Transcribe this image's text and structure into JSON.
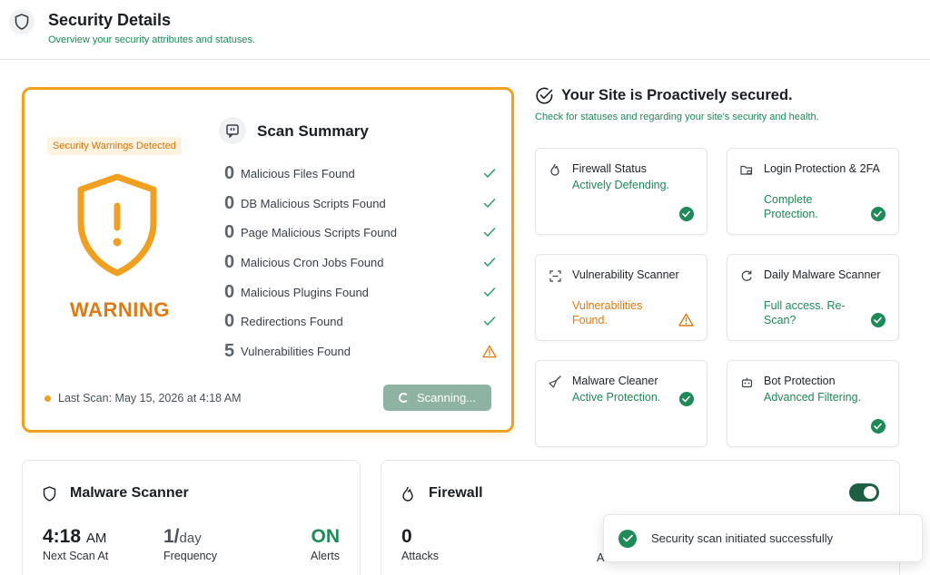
{
  "header": {
    "title": "Security Details",
    "subtitle": "Overview your security attributes and statuses."
  },
  "warning_card": {
    "badge": "Security Warnings Detected",
    "status_label": "WARNING",
    "summary_title": "Scan Summary",
    "items": [
      {
        "count": "0",
        "label": "Malicious Files Found",
        "status": "ok"
      },
      {
        "count": "0",
        "label": "DB Malicious Scripts Found",
        "status": "ok"
      },
      {
        "count": "0",
        "label": "Page Malicious Scripts Found",
        "status": "ok"
      },
      {
        "count": "0",
        "label": "Malicious Cron Jobs Found",
        "status": "ok"
      },
      {
        "count": "0",
        "label": "Malicious Plugins Found",
        "status": "ok"
      },
      {
        "count": "0",
        "label": "Redirections Found",
        "status": "ok"
      },
      {
        "count": "5",
        "label": "Vulnerabilities Found",
        "status": "warning"
      }
    ],
    "last_scan": "Last Scan: May 15, 2026 at 4:18 AM",
    "scan_button": "Scanning..."
  },
  "site_status": {
    "title": "Your Site is Proactively secured.",
    "subtitle": "Check for statuses and regarding your site's security and health.",
    "tiles": [
      {
        "name": "Firewall Status",
        "value": "Actively Defending.",
        "status": "ok",
        "icon": "flame-icon"
      },
      {
        "name": "Login Protection & 2FA",
        "value": "Complete Protection.",
        "status": "ok",
        "icon": "folder-lock-icon"
      },
      {
        "name": "Vulnerability Scanner",
        "value": "Vulnerabilities Found.",
        "status": "warning",
        "icon": "scan-icon"
      },
      {
        "name": "Daily Malware Scanner",
        "value": "Full access. Re-Scan?",
        "status": "ok",
        "icon": "refresh-shield-icon"
      },
      {
        "name": "Malware Cleaner",
        "value": "Active Protection.",
        "status": "ok",
        "icon": "broom-icon"
      },
      {
        "name": "Bot Protection",
        "value": "Advanced Filtering.",
        "status": "ok",
        "icon": "bot-icon"
      }
    ]
  },
  "malware_scanner_card": {
    "title": "Malware Scanner",
    "next_scan_time": "4:18",
    "next_scan_period": "AM",
    "next_scan_label": "Next Scan At",
    "frequency_value": "1/",
    "frequency_unit": "day",
    "frequency_label": "Frequency",
    "alerts_value": "ON",
    "alerts_label": "Alerts"
  },
  "firewall_card": {
    "title": "Firewall",
    "attacks_value": "0",
    "attacks_label": "Attacks",
    "partial_label": "A"
  },
  "toast": {
    "message": "Security scan initiated successfully"
  },
  "colors": {
    "accent_green": "#1e8a57",
    "warning_orange": "#f0a020",
    "warning_text": "#e07a10"
  }
}
